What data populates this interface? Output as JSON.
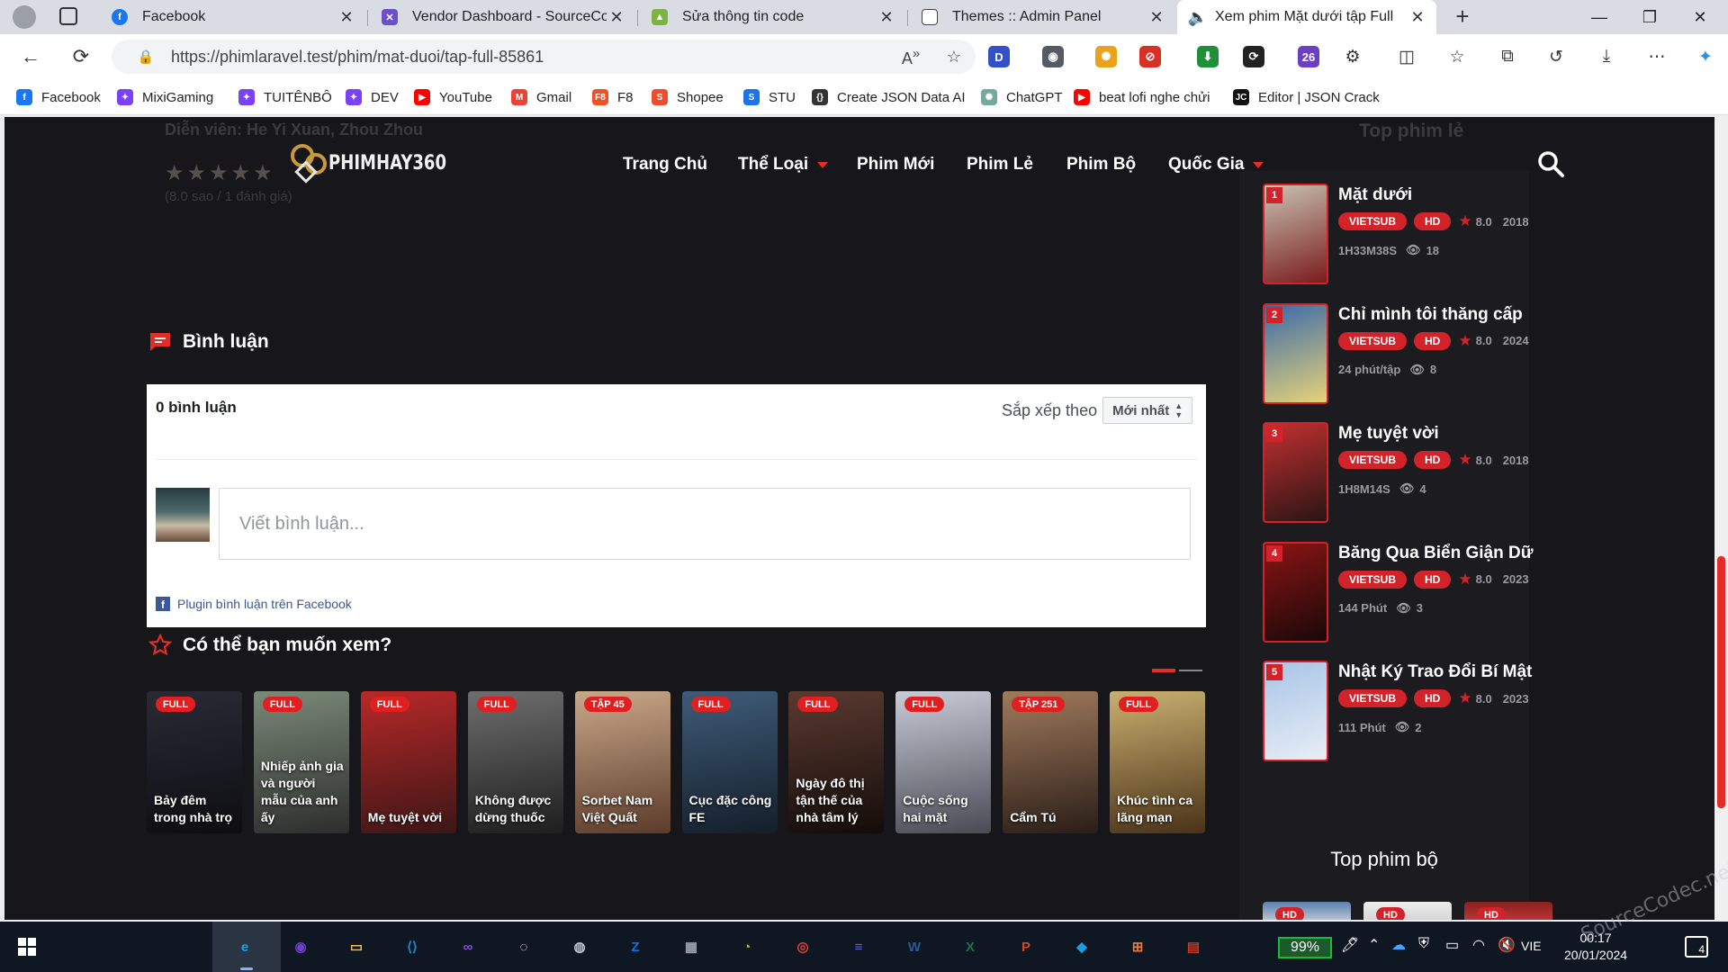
{
  "browser": {
    "tabs": [
      {
        "title": "Facebook",
        "active": false
      },
      {
        "title": "Vendor Dashboard - SourceCodec",
        "active": false
      },
      {
        "title": "Sửa thông tin code",
        "active": false
      },
      {
        "title": "Themes :: Admin Panel",
        "active": false
      },
      {
        "title": "Xem phim Mặt dưới tập Full",
        "active": true
      }
    ],
    "new_tab": "+",
    "url": "https://phimlaravel.test/phim/mat-duoi/tap-full-85861",
    "extensions": [
      {
        "label": "D",
        "color": "#3550c6"
      },
      {
        "label": "◉",
        "color": "#555a66"
      },
      {
        "label": "✺",
        "color": "#e8a21c"
      },
      {
        "label": "⊘",
        "color": "#d93025"
      },
      {
        "label": "⬇",
        "color": "#1f8f3a"
      },
      {
        "label": "⟳",
        "color": "#222222"
      },
      {
        "label": "26",
        "color": "#6a3fc1"
      }
    ]
  },
  "bookmarks": [
    {
      "label": "Facebook",
      "color": "#1877f2",
      "glyph": "f"
    },
    {
      "label": "MixiGaming",
      "color": "#7b42f5",
      "glyph": "✦"
    },
    {
      "label": "TUITÊNBÔ",
      "color": "#7b42f5",
      "glyph": "✦"
    },
    {
      "label": "DEV",
      "color": "#7b42f5",
      "glyph": "✦"
    },
    {
      "label": "YouTube",
      "color": "#ff0000",
      "glyph": "▶"
    },
    {
      "label": "Gmail",
      "color": "#ea4335",
      "glyph": "M"
    },
    {
      "label": "F8",
      "color": "#f05123",
      "glyph": "F8"
    },
    {
      "label": "Shopee",
      "color": "#ee4d2d",
      "glyph": "S"
    },
    {
      "label": "STU",
      "color": "#1a73e8",
      "glyph": "S"
    },
    {
      "label": "Create JSON Data AI",
      "color": "#333333",
      "glyph": "{}"
    },
    {
      "label": "ChatGPT",
      "color": "#74aa9c",
      "glyph": "✺"
    },
    {
      "label": "beat lofi nghe chửi",
      "color": "#ff0000",
      "glyph": "▶"
    },
    {
      "label": "Editor | JSON Crack",
      "color": "#111111",
      "glyph": "JC"
    }
  ],
  "page": {
    "ghost_actors": "Diễn viên: He Yi Xuan, Zhou Zhou",
    "ghost_stars": "★★★★★",
    "ghost_rating": "(8.0 sao / 1 đánh giá)",
    "logo_text": "PHIMHAY360",
    "nav": [
      {
        "label": "Trang Chủ",
        "dropdown": false
      },
      {
        "label": "Thể Loại",
        "dropdown": true
      },
      {
        "label": "Phim Mới",
        "dropdown": false
      },
      {
        "label": "Phim Lẻ",
        "dropdown": false
      },
      {
        "label": "Phim Bộ",
        "dropdown": false
      },
      {
        "label": "Quốc Gia",
        "dropdown": true
      }
    ],
    "comments": {
      "title": "Bình luận",
      "count": "0 bình luận",
      "sort_label": "Sắp xếp theo",
      "sort_value": "Mới nhất",
      "placeholder": "Viết bình luận...",
      "plugin": "Plugin bình luận trên Facebook"
    },
    "recommend": {
      "title": "Có thể bạn muốn xem?",
      "items": [
        {
          "badge": "FULL",
          "title": "Bảy đêm trong nhà trọ",
          "colors": [
            "#2a2a35",
            "#0d0d12"
          ]
        },
        {
          "badge": "FULL",
          "title": "Nhiếp ảnh gia và người mẫu của anh ấy",
          "colors": [
            "#7a8a78",
            "#2d2d2d"
          ]
        },
        {
          "badge": "FULL",
          "title": "Mẹ tuyệt vời",
          "colors": [
            "#b82828",
            "#3d1616"
          ]
        },
        {
          "badge": "FULL",
          "title": "Không được dừng thuốc",
          "colors": [
            "#6e6e6e",
            "#1e1e1e"
          ]
        },
        {
          "badge": "TẬP 45",
          "title": "Sorbet Nam Việt Quất",
          "colors": [
            "#c9a88a",
            "#5b3b2a"
          ]
        },
        {
          "badge": "FULL",
          "title": "Cục đặc công FE",
          "colors": [
            "#3e5c78",
            "#141e2a"
          ]
        },
        {
          "badge": "FULL",
          "title": "Ngày đô thị tận thế của nhà tâm lý",
          "colors": [
            "#5a3a30",
            "#140c0a"
          ]
        },
        {
          "badge": "FULL",
          "title": "Cuộc sống hai mặt",
          "colors": [
            "#c8ccd6",
            "#4a4a55"
          ]
        },
        {
          "badge": "TẬP 251",
          "title": "Cẩm Tú",
          "colors": [
            "#a07a5c",
            "#2a1e18"
          ]
        },
        {
          "badge": "FULL",
          "title": "Khúc tình ca lãng mạn",
          "colors": [
            "#c9b070",
            "#4a3218"
          ]
        }
      ]
    },
    "sidebar": {
      "ghost_title": "Top phim lẻ",
      "items": [
        {
          "rank": "1",
          "name": "Mặt dưới",
          "sub": "VIETSUB",
          "quality": "HD",
          "score": "8.0",
          "year": "2018",
          "duration": "1H33M38S",
          "views": "18",
          "colors": [
            "#c8c2b2",
            "#7a1c1c"
          ]
        },
        {
          "rank": "2",
          "name": "Chỉ mình tôi thăng cấp",
          "sub": "VIETSUB",
          "quality": "HD",
          "score": "8.0",
          "year": "2024",
          "duration": "24 phút/tập",
          "views": "8",
          "colors": [
            "#3a6aa8",
            "#e6d27a"
          ]
        },
        {
          "rank": "3",
          "name": "Mẹ tuyệt vời",
          "sub": "VIETSUB",
          "quality": "HD",
          "score": "8.0",
          "year": "2018",
          "duration": "1H8M14S",
          "views": "4",
          "colors": [
            "#c23030",
            "#2a1414"
          ]
        },
        {
          "rank": "4",
          "name": "Băng Qua Biển Giận Dữ",
          "sub": "VIETSUB",
          "quality": "HD",
          "score": "8.0",
          "year": "2023",
          "duration": "144 Phút",
          "views": "3",
          "colors": [
            "#8a1414",
            "#1a0808"
          ]
        },
        {
          "rank": "5",
          "name": "Nhật Ký Trao Đổi Bí Mật",
          "sub": "VIETSUB",
          "quality": "HD",
          "score": "8.0",
          "year": "2023",
          "duration": "111 Phút",
          "views": "2",
          "colors": [
            "#a8c4e6",
            "#e8eef6"
          ]
        }
      ],
      "series_title": "Top phim bộ",
      "series_badges": [
        "HD",
        "HD",
        "HD"
      ]
    }
  },
  "taskbar": {
    "battery": "99%",
    "lang": "VIE",
    "time": "00:17",
    "date": "20/01/2024",
    "notif": "4",
    "watermark": "SourceCodec.net"
  }
}
